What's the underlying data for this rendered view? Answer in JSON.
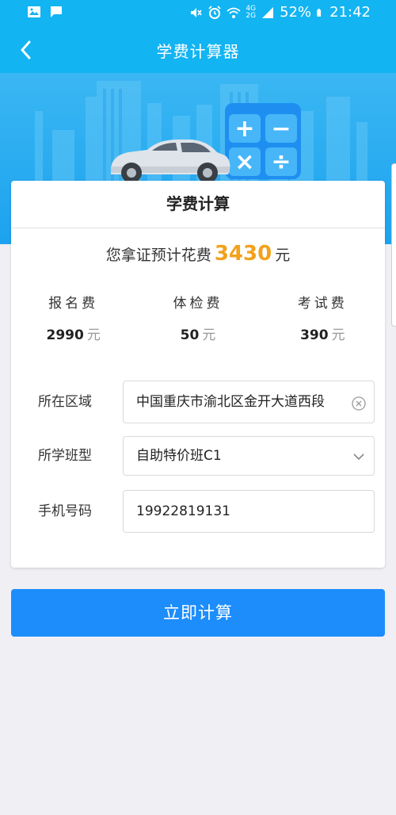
{
  "status_bar": {
    "battery": "52%",
    "time": "21:42",
    "network_top": "4G",
    "network_bottom": "2G",
    "icons": [
      "gallery-icon",
      "message-icon",
      "mute-icon",
      "alarm-icon",
      "wifi-icon",
      "signal-icon",
      "battery-icon"
    ]
  },
  "nav": {
    "title": "学费计算器",
    "back_icon": "chevron-left-icon"
  },
  "banner": {
    "calculator_symbols": [
      "+",
      "−",
      "×",
      "÷"
    ]
  },
  "card": {
    "title": "学费计算",
    "total_prefix": "您拿证预计花费",
    "total_amount": "3430",
    "total_unit": "元",
    "fees": [
      {
        "label": "报名费",
        "value": "2990",
        "unit": "元"
      },
      {
        "label": "体检费",
        "value": "50",
        "unit": "元"
      },
      {
        "label": "考试费",
        "value": "390",
        "unit": "元"
      }
    ],
    "form": {
      "region_label": "所在区域",
      "region_value": "中国重庆市渝北区金开大道西段",
      "class_label": "所学班型",
      "class_value": "自助特价班C1",
      "phone_label": "手机号码",
      "phone_value": "19922819131"
    }
  },
  "submit_label": "立即计算",
  "colors": {
    "primary": "#12b4f2",
    "button": "#1d8dfb",
    "accent": "#f2a11d",
    "background": "#efeff4"
  }
}
